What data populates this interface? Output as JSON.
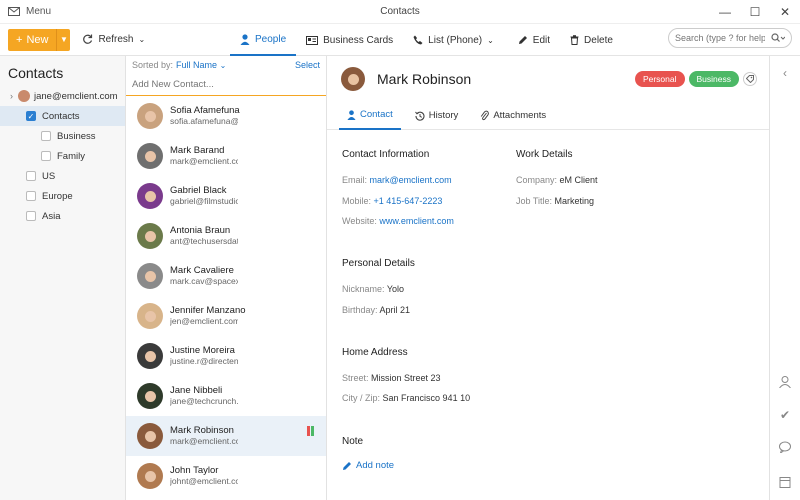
{
  "window": {
    "menu_label": "Menu",
    "title": "Contacts",
    "controls": [
      "—",
      "☐",
      "✕"
    ]
  },
  "toolbar": {
    "new_label": "New",
    "refresh_label": "Refresh",
    "view_tabs": [
      {
        "label": "People",
        "icon": "person-icon",
        "active": true
      },
      {
        "label": "Business Cards",
        "icon": "card-icon",
        "active": false
      },
      {
        "label": "List (Phone)",
        "icon": "phone-icon",
        "active": false
      }
    ],
    "edit_label": "Edit",
    "delete_label": "Delete",
    "search_placeholder": "Search (type ? for help)"
  },
  "folders": {
    "title": "Contacts",
    "account": "jane@emclient.com",
    "items": [
      {
        "label": "Contacts",
        "checked": true,
        "selected": true,
        "indent": 1
      },
      {
        "label": "Business",
        "checked": false,
        "selected": false,
        "indent": 2
      },
      {
        "label": "Family",
        "checked": false,
        "selected": false,
        "indent": 2
      },
      {
        "label": "US",
        "checked": false,
        "selected": false,
        "indent": 1
      },
      {
        "label": "Europe",
        "checked": false,
        "selected": false,
        "indent": 1
      },
      {
        "label": "Asia",
        "checked": false,
        "selected": false,
        "indent": 1
      }
    ]
  },
  "list": {
    "sorted_by_label": "Sorted by:",
    "sorted_by_value": "Full Name",
    "select_label": "Select",
    "add_placeholder": "Add New Contact...",
    "contacts": [
      {
        "name": "Sofia Afamefuna",
        "email": "sofia.afamefuna@ib",
        "avatar_color": "#c9a27e"
      },
      {
        "name": "Mark Barand",
        "email": "mark@emclient.com",
        "avatar_color": "#6f6f6f"
      },
      {
        "name": "Gabriel Black",
        "email": "gabriel@filmstudioe",
        "avatar_color": "#7a3a8c"
      },
      {
        "name": "Antonia Braun",
        "email": "ant@techusersdata.",
        "avatar_color": "#6b7a4a"
      },
      {
        "name": "Mark Cavaliere",
        "email": "mark.cav@spacex.cc",
        "avatar_color": "#8a8a8a"
      },
      {
        "name": "Jennifer Manzano",
        "email": "jen@emclient.com",
        "avatar_color": "#d8b48a"
      },
      {
        "name": "Justine Moreira",
        "email": "justine.r@directener",
        "avatar_color": "#3a3a3a"
      },
      {
        "name": "Jane Nibbeli",
        "email": "jane@techcrunch.co",
        "avatar_color": "#2e3a2a"
      },
      {
        "name": "Mark Robinson",
        "email": "mark@emclient.com",
        "avatar_color": "#8a5a3c",
        "selected": true
      },
      {
        "name": "John Taylor",
        "email": "johnt@emclient.com",
        "avatar_color": "#b07a50"
      }
    ],
    "category_colors": [
      "#e8534f",
      "#4cb866"
    ]
  },
  "detail": {
    "name": "Mark Robinson",
    "tags": [
      {
        "label": "Personal",
        "color": "#e8534f"
      },
      {
        "label": "Business",
        "color": "#4cb866"
      }
    ],
    "tabs": [
      {
        "label": "Contact",
        "active": true
      },
      {
        "label": "History",
        "active": false
      },
      {
        "label": "Attachments",
        "active": false
      }
    ],
    "contact_info": {
      "title": "Contact Information",
      "email_label": "Email:",
      "email": "mark@emclient.com",
      "mobile_label": "Mobile:",
      "mobile": "+1 415-647-2223",
      "website_label": "Website:",
      "website": "www.emclient.com"
    },
    "work": {
      "title": "Work Details",
      "company_label": "Company:",
      "company": "eM Client",
      "job_label": "Job Title:",
      "job": "Marketing"
    },
    "personal": {
      "title": "Personal Details",
      "nickname_label": "Nickname:",
      "nickname": "Yolo",
      "birthday_label": "Birthday:",
      "birthday": "April 21"
    },
    "address": {
      "title": "Home Address",
      "street_label": "Street:",
      "street": "Mission Street 23",
      "city_label": "City / Zip:",
      "city": "San Francisco 941 10"
    },
    "note": {
      "title": "Note",
      "add_label": "Add note"
    }
  }
}
